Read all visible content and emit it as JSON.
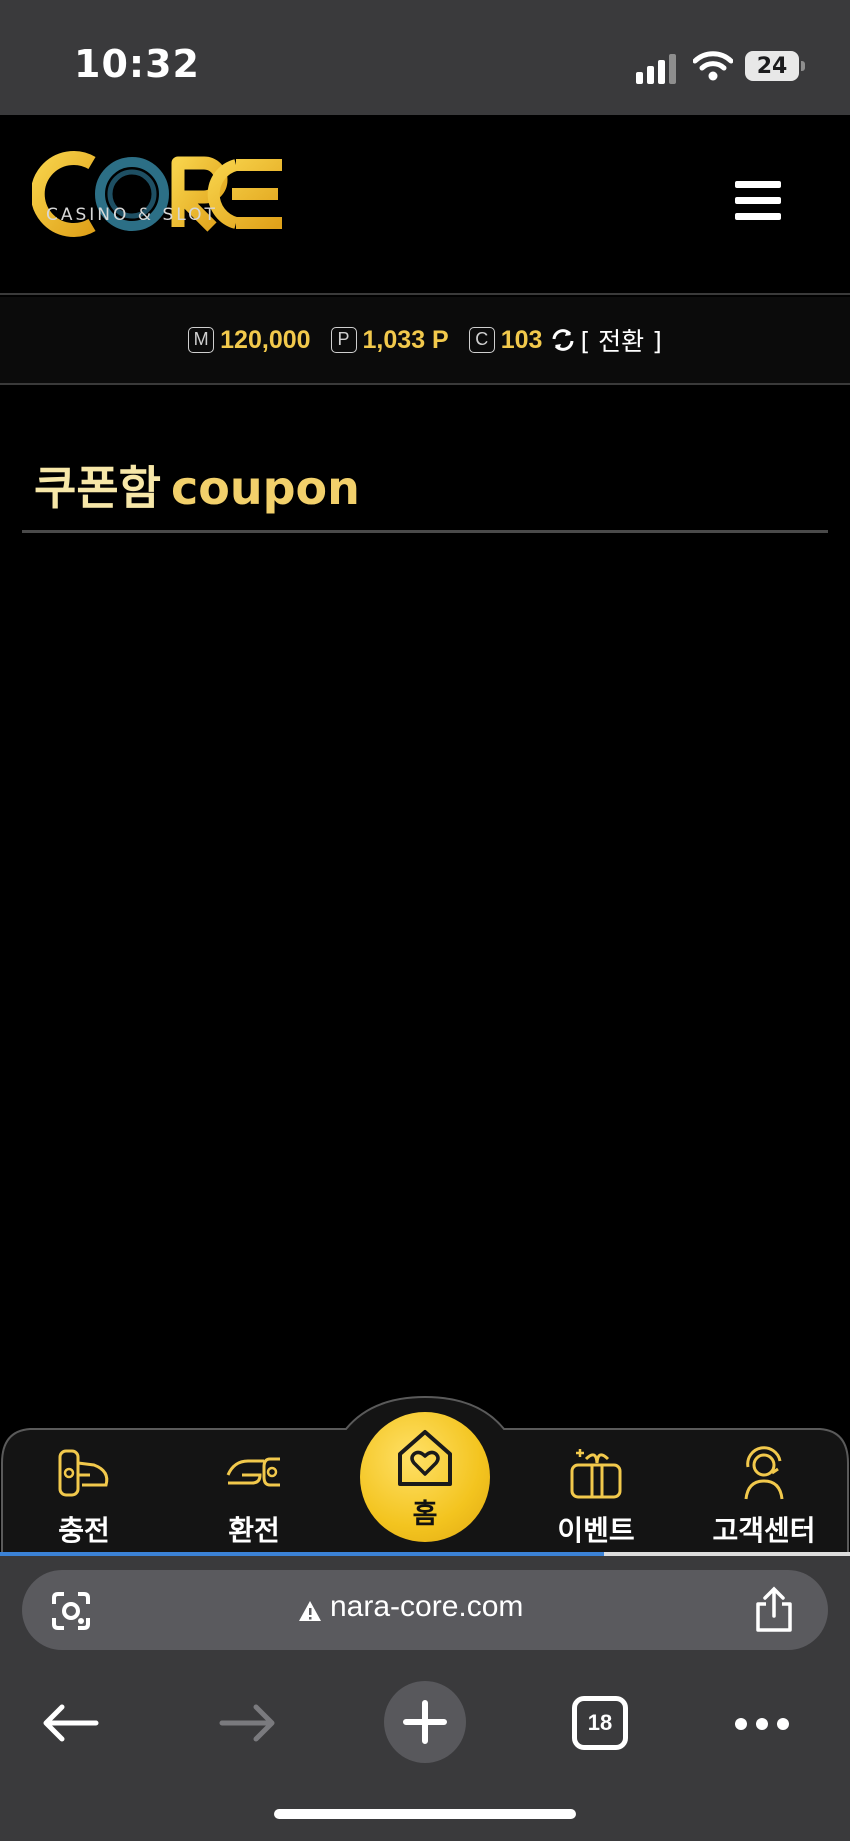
{
  "status_bar": {
    "time": "10:32",
    "battery": "24"
  },
  "header": {
    "logo_text": "CORE",
    "logo_subtitle": "CASINO & SLOT",
    "menu_icon": "hamburger-menu-icon"
  },
  "balance": {
    "money_badge": "M",
    "money_value": "120,000",
    "point_badge": "P",
    "point_value": "1,033 P",
    "coupon_badge": "C",
    "coupon_value": "103",
    "convert_label": "[ 전환 ]"
  },
  "page": {
    "title": "쿠폰함",
    "subtitle": "coupon"
  },
  "bottom_nav": {
    "items": [
      {
        "label": "충전",
        "icon": "deposit-hand-icon"
      },
      {
        "label": "환전",
        "icon": "withdraw-hand-icon"
      },
      {
        "label": "홈",
        "icon": "home-heart-icon"
      },
      {
        "label": "이벤트",
        "icon": "gift-box-icon"
      },
      {
        "label": "고객센터",
        "icon": "support-agent-icon"
      }
    ],
    "page_load_progress": 0.71
  },
  "browser": {
    "url": "nara-core.com",
    "tab_count": "18"
  },
  "colors": {
    "accent": "#f2c94c",
    "background": "#000000",
    "chrome": "#3a3a3c",
    "progress": "#3b82d6"
  }
}
